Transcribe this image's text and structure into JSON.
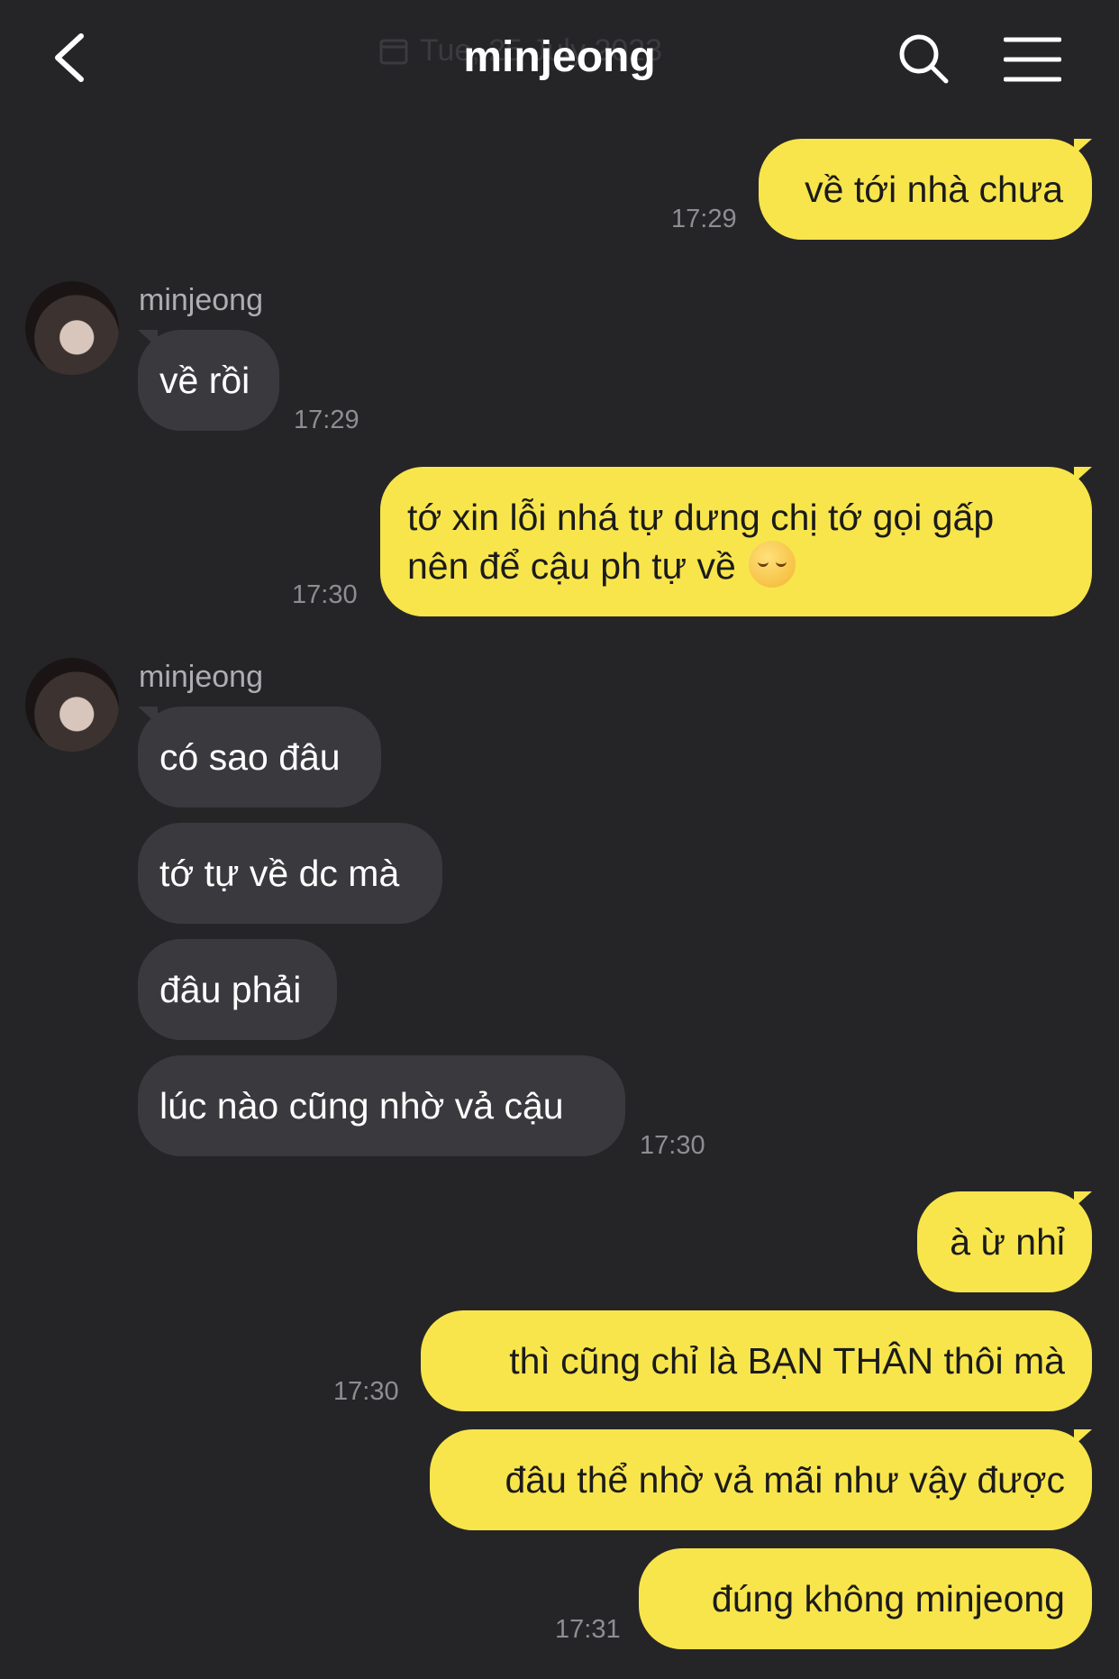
{
  "header": {
    "title": "minjeong",
    "date_hint": "Tue, 25 July 2023"
  },
  "contact": {
    "name": "minjeong"
  },
  "colors": {
    "background": "#252528",
    "outgoing": "#f8e54c",
    "incoming": "#3a3a3e",
    "time": "#8e8e92"
  },
  "messages": [
    {
      "text": "về tới nhà chưa",
      "time": "17:29"
    },
    {
      "text": "về rồi",
      "time": "17:29"
    },
    {
      "line1": "tớ xin lỗi nhá tự dưng chị tớ gọi gấp",
      "line2": "nên để cậu ph tự về",
      "emoji": "pensive-face",
      "time": "17:30"
    },
    {
      "text": "có sao đâu"
    },
    {
      "text": "tớ tự về dc mà"
    },
    {
      "text": "đâu phải"
    },
    {
      "text": "lúc nào cũng nhờ vả cậu",
      "time": "17:30"
    },
    {
      "text": "à ừ nhỉ"
    },
    {
      "text": "thì cũng chỉ là BẠN THÂN thôi mà",
      "time": "17:30"
    },
    {
      "text": "đâu thể nhờ vả mãi như vậy được"
    },
    {
      "text": "đúng không minjeong",
      "time": "17:31"
    }
  ]
}
